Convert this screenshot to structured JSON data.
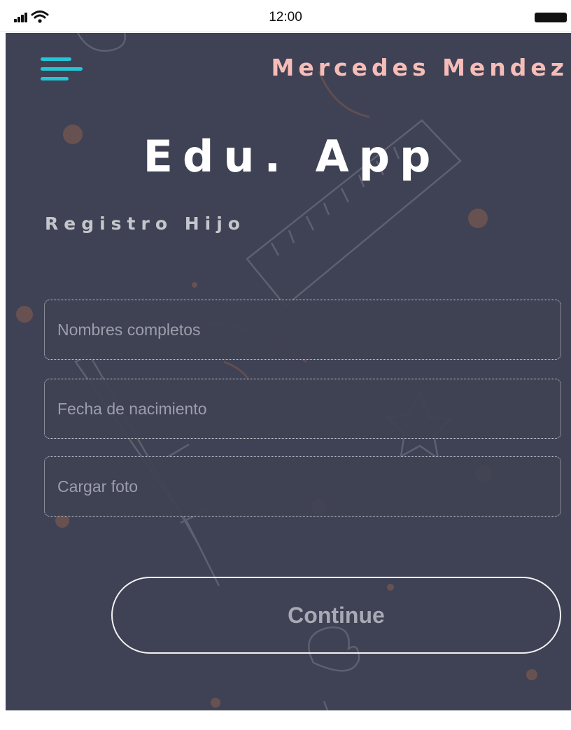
{
  "status_bar": {
    "time": "12:00",
    "icons": [
      "signal-icon",
      "wifi-icon",
      "battery-icon"
    ]
  },
  "header": {
    "menu_icon": "hamburger-menu-icon",
    "user_name": "Mercedes Mendez"
  },
  "app": {
    "title": "Edu. App",
    "section_title": "Registro Hijo"
  },
  "form": {
    "full_name": {
      "placeholder": "Nombres completos",
      "value": ""
    },
    "birth_date": {
      "placeholder": "Fecha de nacimiento",
      "value": ""
    },
    "photo": {
      "placeholder": "Cargar foto",
      "value": ""
    },
    "continue_label": "Continue"
  },
  "colors": {
    "background": "#3f4254",
    "accent": "#22c7d6",
    "user_name": "#f6bdb8",
    "title": "#ffffff",
    "doodle_orange": "#8a5e4e"
  }
}
